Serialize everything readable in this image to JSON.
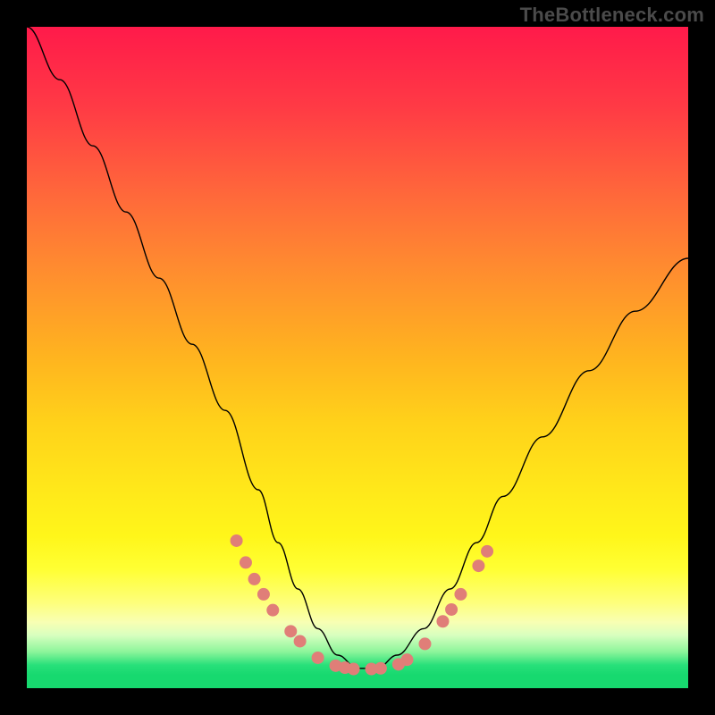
{
  "watermark": "TheBottleneck.com",
  "chart_data": {
    "type": "line",
    "title": "",
    "xlabel": "",
    "ylabel": "",
    "xlim": [
      0,
      1
    ],
    "ylim": [
      0,
      1
    ],
    "background_gradient": [
      "#ff1a4a",
      "#ff8a30",
      "#ffe81a",
      "#feff7a",
      "#8cf59a",
      "#17d96f"
    ],
    "series": [
      {
        "name": "bottleneck-curve",
        "x": [
          0.0,
          0.05,
          0.1,
          0.15,
          0.2,
          0.25,
          0.3,
          0.35,
          0.38,
          0.41,
          0.44,
          0.47,
          0.5,
          0.53,
          0.56,
          0.6,
          0.64,
          0.68,
          0.72,
          0.78,
          0.85,
          0.92,
          1.0
        ],
        "values": [
          1.0,
          0.92,
          0.82,
          0.72,
          0.62,
          0.52,
          0.42,
          0.3,
          0.22,
          0.15,
          0.09,
          0.05,
          0.03,
          0.03,
          0.05,
          0.09,
          0.15,
          0.22,
          0.29,
          0.38,
          0.48,
          0.57,
          0.65
        ]
      }
    ],
    "highlight_points": [
      {
        "x": 0.317,
        "y": 0.223
      },
      {
        "x": 0.331,
        "y": 0.19
      },
      {
        "x": 0.344,
        "y": 0.165
      },
      {
        "x": 0.358,
        "y": 0.142
      },
      {
        "x": 0.372,
        "y": 0.118
      },
      {
        "x": 0.399,
        "y": 0.086
      },
      {
        "x": 0.413,
        "y": 0.071
      },
      {
        "x": 0.44,
        "y": 0.046
      },
      {
        "x": 0.467,
        "y": 0.034
      },
      {
        "x": 0.481,
        "y": 0.031
      },
      {
        "x": 0.494,
        "y": 0.029
      },
      {
        "x": 0.521,
        "y": 0.029
      },
      {
        "x": 0.535,
        "y": 0.03
      },
      {
        "x": 0.562,
        "y": 0.036
      },
      {
        "x": 0.575,
        "y": 0.043
      },
      {
        "x": 0.602,
        "y": 0.067
      },
      {
        "x": 0.629,
        "y": 0.101
      },
      {
        "x": 0.642,
        "y": 0.119
      },
      {
        "x": 0.656,
        "y": 0.142
      },
      {
        "x": 0.683,
        "y": 0.185
      },
      {
        "x": 0.696,
        "y": 0.207
      }
    ]
  }
}
